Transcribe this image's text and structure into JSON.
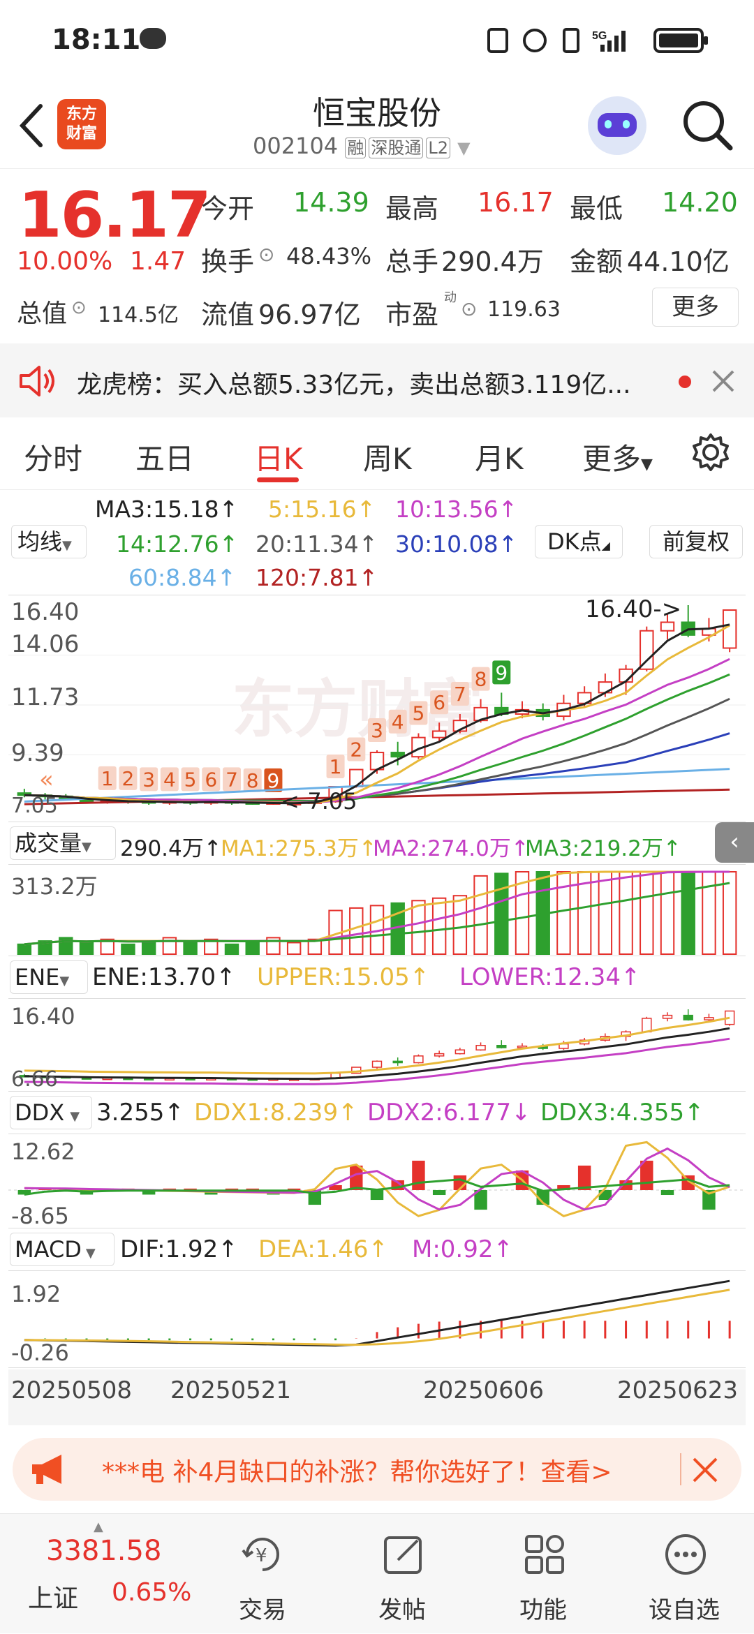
{
  "status": {
    "time": "18:11",
    "signal_label": "5G"
  },
  "header": {
    "title": "恒宝股份",
    "code": "002104",
    "tags": [
      "融",
      "深股通",
      "L2"
    ],
    "logo_text": [
      "东方",
      "财富"
    ]
  },
  "quote": {
    "price": "16.17",
    "change_pct": "10.00%",
    "change": "1.47",
    "open_label": "今开",
    "open": "14.39",
    "high_label": "最高",
    "high": "16.17",
    "low_label": "最低",
    "low": "14.20",
    "turnover_label": "换手",
    "turnover": "48.43%",
    "volume_label": "总手",
    "volume": "290.4万",
    "amount_label": "金额",
    "amount": "44.10亿",
    "mktcap_label": "总值",
    "mktcap": "114.5亿",
    "float_label": "流值",
    "float_cap": "96.97亿",
    "pe_label": "市盈",
    "pe_sup": "动",
    "pe": "119.63",
    "more_button": "更多"
  },
  "notice": {
    "text": "龙虎榜：买入总额5.33亿元，卖出总额3.119亿..."
  },
  "tabs": [
    "分时",
    "五日",
    "日K",
    "周K",
    "月K",
    "更多"
  ],
  "active_tab": 2,
  "ma_panel": {
    "selector": "均线",
    "dk_button": "DK点",
    "adjust_button": "前复权",
    "ma3": "MA3:15.18↑",
    "ma5": "5:15.16↑",
    "ma10": "10:13.56↑",
    "ma14": "14:12.76↑",
    "ma20": "20:11.34↑",
    "ma30": "30:10.08↑",
    "ma60": "60:8.84↑",
    "ma120": "120:7.81↑"
  },
  "kline": {
    "y_labels": [
      "16.40",
      "14.06",
      "11.73",
      "9.39",
      "7.05"
    ],
    "max_label": "16.40->",
    "min_label": "<-7.05",
    "watermark": "东方财富"
  },
  "volume": {
    "selector": "成交量",
    "value": "290.4万↑",
    "ma1": "MA1:275.3万↑",
    "ma2": "MA2:274.0万↑",
    "ma3": "MA3:219.2万↑",
    "y_label": "313.2万"
  },
  "ene": {
    "selector": "ENE",
    "ene": "ENE:13.70↑",
    "upper": "UPPER:15.05↑",
    "lower": "LOWER:12.34↑",
    "y_top": "16.40",
    "y_bottom": "6.66"
  },
  "ddx": {
    "selector": "DDX",
    "value": "3.255↑",
    "ddx1": "DDX1:8.239↑",
    "ddx2": "DDX2:6.177↓",
    "ddx3": "DDX3:4.355↑",
    "y_top": "12.62",
    "y_bottom": "-8.65"
  },
  "macd": {
    "selector": "MACD",
    "dif": "DIF:1.92↑",
    "dea": "DEA:1.46↑",
    "m": "M:0.92↑",
    "y_top": "1.92",
    "y_bottom": "-0.26"
  },
  "dates": [
    "20250508",
    "20250521",
    "20250606",
    "20250623"
  ],
  "ad": {
    "text": "***电 补4月缺口的补涨？帮你选好了！查看>"
  },
  "bottom": {
    "index_value": "3381.58",
    "index_name": "上证",
    "index_change": "0.65%",
    "nav": [
      "交易",
      "发帖",
      "功能",
      "设自选"
    ]
  },
  "colors": {
    "up": "#e5312c",
    "down": "#2ea02e",
    "ma5": "#e8b93a",
    "ma10": "#c43fc4",
    "ma30": "#2a3fb8",
    "ma60": "#6ab0e6",
    "ma120": "#b22222"
  },
  "chart_data": {
    "type": "candlestick",
    "y_range": [
      7.05,
      16.4
    ],
    "candles": [
      {
        "o": 7.6,
        "c": 7.5,
        "h": 7.8,
        "l": 7.4
      },
      {
        "o": 7.5,
        "c": 7.45,
        "h": 7.6,
        "l": 7.3
      },
      {
        "o": 7.45,
        "c": 7.35,
        "h": 7.55,
        "l": 7.25
      },
      {
        "o": 7.3,
        "c": 7.2,
        "h": 7.4,
        "l": 7.1
      },
      {
        "o": 7.2,
        "c": 7.25,
        "h": 7.35,
        "l": 7.1
      },
      {
        "o": 7.25,
        "c": 7.2,
        "h": 7.35,
        "l": 7.1
      },
      {
        "o": 7.2,
        "c": 7.15,
        "h": 7.3,
        "l": 7.05
      },
      {
        "o": 7.15,
        "c": 7.2,
        "h": 7.3,
        "l": 7.05
      },
      {
        "o": 7.2,
        "c": 7.15,
        "h": 7.3,
        "l": 7.05
      },
      {
        "o": 7.15,
        "c": 7.2,
        "h": 7.3,
        "l": 7.05
      },
      {
        "o": 7.2,
        "c": 7.15,
        "h": 7.3,
        "l": 7.05
      },
      {
        "o": 7.15,
        "c": 7.1,
        "h": 7.25,
        "l": 7.05
      },
      {
        "o": 7.1,
        "c": 7.15,
        "h": 7.25,
        "l": 7.05
      },
      {
        "o": 7.1,
        "c": 7.12,
        "h": 7.2,
        "l": 7.05
      },
      {
        "o": 7.12,
        "c": 7.2,
        "h": 7.3,
        "l": 7.05
      },
      {
        "o": 7.2,
        "c": 7.9,
        "h": 7.9,
        "l": 7.15
      },
      {
        "o": 7.9,
        "c": 8.7,
        "h": 8.7,
        "l": 7.85
      },
      {
        "o": 8.7,
        "c": 9.5,
        "h": 9.6,
        "l": 8.5
      },
      {
        "o": 9.5,
        "c": 9.3,
        "h": 10.0,
        "l": 8.9
      },
      {
        "o": 9.3,
        "c": 10.2,
        "h": 10.4,
        "l": 9.2
      },
      {
        "o": 10.2,
        "c": 10.5,
        "h": 10.9,
        "l": 10.0
      },
      {
        "o": 10.5,
        "c": 11.0,
        "h": 11.3,
        "l": 10.4
      },
      {
        "o": 11.0,
        "c": 11.6,
        "h": 12.0,
        "l": 10.9
      },
      {
        "o": 11.6,
        "c": 11.3,
        "h": 12.3,
        "l": 11.2
      },
      {
        "o": 11.3,
        "c": 11.5,
        "h": 11.9,
        "l": 11.1
      },
      {
        "o": 11.5,
        "c": 11.2,
        "h": 11.8,
        "l": 11.0
      },
      {
        "o": 11.2,
        "c": 11.8,
        "h": 12.2,
        "l": 11.0
      },
      {
        "o": 11.8,
        "c": 12.3,
        "h": 12.6,
        "l": 11.6
      },
      {
        "o": 12.3,
        "c": 12.8,
        "h": 13.2,
        "l": 12.1
      },
      {
        "o": 12.8,
        "c": 13.4,
        "h": 13.6,
        "l": 12.2
      },
      {
        "o": 13.4,
        "c": 15.2,
        "h": 15.4,
        "l": 13.3
      },
      {
        "o": 15.2,
        "c": 15.6,
        "h": 16.0,
        "l": 14.8
      },
      {
        "o": 15.6,
        "c": 15.0,
        "h": 16.4,
        "l": 14.9
      },
      {
        "o": 15.0,
        "c": 15.3,
        "h": 15.8,
        "l": 14.7
      },
      {
        "o": 14.39,
        "c": 16.17,
        "h": 16.17,
        "l": 14.2
      }
    ]
  }
}
